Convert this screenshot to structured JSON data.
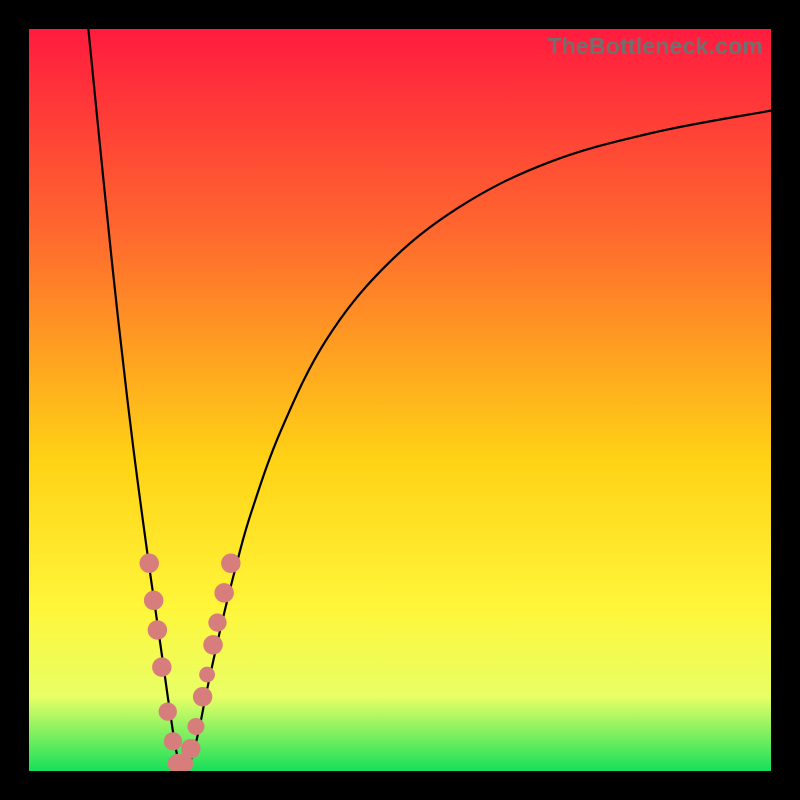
{
  "watermark": "TheBottleneck.com",
  "colors": {
    "black": "#000000",
    "curve": "#000000",
    "marker_fill": "#d77d7b",
    "marker_stroke": "#b14c49",
    "grad_top": "#ff1b3f",
    "grad_mid1": "#ff6a2e",
    "grad_mid2": "#ffd215",
    "grad_mid3": "#fff63a",
    "grad_mid4": "#e8ff66",
    "grad_bot": "#16e05a"
  },
  "chart_data": {
    "type": "line",
    "title": "",
    "xlabel": "",
    "ylabel": "",
    "xlim": [
      0,
      100
    ],
    "ylim": [
      0,
      100
    ],
    "notes": "Bottleneck percentage curve; minimum near x≈20 where bottleneck ≈ 0%. Background gradient maps bottleneck severity (green=low at bottom to red=high at top). No axis ticks or gridlines shown.",
    "series": [
      {
        "name": "bottleneck-curve",
        "x": [
          8,
          10,
          12,
          14,
          16,
          17,
          18,
          19,
          20,
          21,
          22,
          23,
          24,
          26,
          28,
          30,
          34,
          40,
          48,
          58,
          70,
          84,
          100
        ],
        "y": [
          100,
          80,
          61,
          44,
          29,
          22,
          15,
          8,
          2,
          0,
          2,
          6,
          11,
          20,
          28,
          35,
          46,
          58,
          68,
          76,
          82,
          86,
          89
        ]
      }
    ],
    "markers": [
      {
        "x": 16.2,
        "y": 28,
        "r": 1.6
      },
      {
        "x": 16.8,
        "y": 23,
        "r": 1.6
      },
      {
        "x": 17.3,
        "y": 19,
        "r": 1.6
      },
      {
        "x": 17.9,
        "y": 14,
        "r": 1.6
      },
      {
        "x": 18.7,
        "y": 8,
        "r": 1.5
      },
      {
        "x": 19.4,
        "y": 4,
        "r": 1.5
      },
      {
        "x": 20.0,
        "y": 1,
        "r": 1.6
      },
      {
        "x": 20.8,
        "y": 1,
        "r": 1.6
      },
      {
        "x": 21.8,
        "y": 3,
        "r": 1.6
      },
      {
        "x": 22.5,
        "y": 6,
        "r": 1.4
      },
      {
        "x": 23.4,
        "y": 10,
        "r": 1.6
      },
      {
        "x": 24.0,
        "y": 13,
        "r": 1.3
      },
      {
        "x": 24.8,
        "y": 17,
        "r": 1.6
      },
      {
        "x": 25.4,
        "y": 20,
        "r": 1.5
      },
      {
        "x": 26.3,
        "y": 24,
        "r": 1.6
      },
      {
        "x": 27.2,
        "y": 28,
        "r": 1.6
      }
    ]
  }
}
